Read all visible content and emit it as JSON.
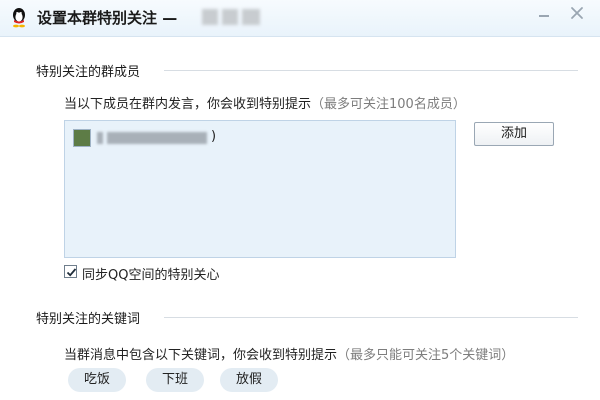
{
  "window": {
    "title": "设置本群特别关注 —",
    "title_redacted": true
  },
  "titlebar": {
    "min_icon": "minimize-icon",
    "close_icon": "close-icon",
    "logo_icon": "qq-penguin-icon"
  },
  "members_section": {
    "title": "特别关注的群成员",
    "description": "当以下成员在群内发言，你会收到特别提示",
    "hint": "（最多可关注100名成员）",
    "items": [
      {
        "name_redacted": true,
        "name_suffix": ")"
      }
    ],
    "add_label": "添加",
    "sync_checkbox": {
      "label": "同步QQ空间的特别关心",
      "checked": true
    }
  },
  "keywords_section": {
    "title": "特别关注的关键词",
    "description": "当群消息中包含以下关键词，你会收到特别提示",
    "hint": "（最多只能可关注5个关键词）",
    "keywords": [
      "吃饭",
      "下班",
      "放假"
    ]
  },
  "colors": {
    "list_background": "#e8f2fa",
    "hint_text": "#7d7d7d",
    "chip_background": "#e3ecf3"
  }
}
